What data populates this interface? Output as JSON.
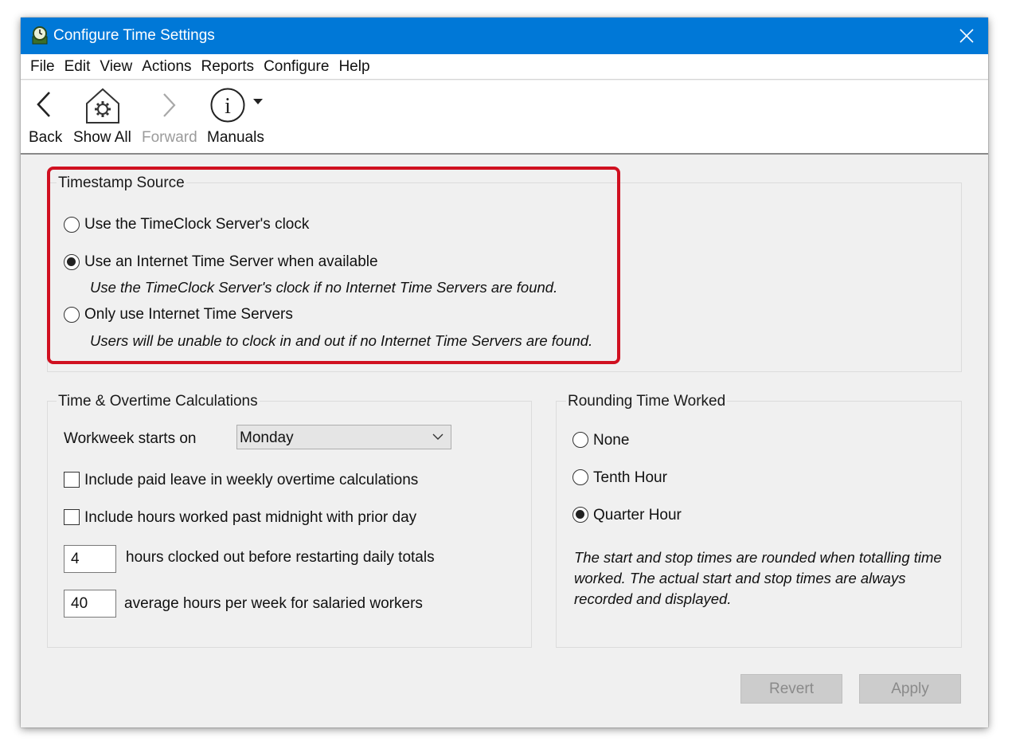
{
  "window": {
    "title": "Configure Time Settings",
    "accent_color": "#0078d7"
  },
  "menu": [
    "File",
    "Edit",
    "View",
    "Actions",
    "Reports",
    "Configure",
    "Help"
  ],
  "toolbar": {
    "back_label": "Back",
    "show_all_label": "Show All",
    "forward_label": "Forward",
    "manuals_label": "Manuals"
  },
  "timestamp_source": {
    "title": "Timestamp Source",
    "option_server_clock": "Use the TimeClock Server's clock",
    "option_internet_when_available": "Use an Internet Time Server when available",
    "note_internet_when_available": "Use the TimeClock Server's clock if no Internet Time Servers are found.",
    "option_only_internet": "Only use Internet Time Servers",
    "note_only_internet": "Users will be unable to clock in and out if no Internet Time Servers are found.",
    "selected": "option_internet_when_available",
    "highlight_color": "#d01020"
  },
  "time_overtime": {
    "title": "Time & Overtime Calculations",
    "workweek_label": "Workweek starts on",
    "workweek_value": "Monday",
    "include_paid_leave_label": "Include paid leave in weekly overtime calculations",
    "include_paid_leave_checked": false,
    "include_midnight_label": "Include hours worked past midnight with prior day",
    "include_midnight_checked": false,
    "hours_clocked_out_value": "4",
    "hours_clocked_out_label": "hours clocked out before restarting daily totals",
    "avg_hours_value": "40",
    "avg_hours_label": "average hours per week for salaried workers"
  },
  "rounding": {
    "title": "Rounding Time Worked",
    "option_none": "None",
    "option_tenth": "Tenth Hour",
    "option_quarter": "Quarter Hour",
    "selected": "option_quarter",
    "note": "The start and stop times are rounded when totalling time worked. The actual start and stop times are always recorded and displayed."
  },
  "buttons": {
    "revert_label": "Revert",
    "apply_label": "Apply"
  }
}
